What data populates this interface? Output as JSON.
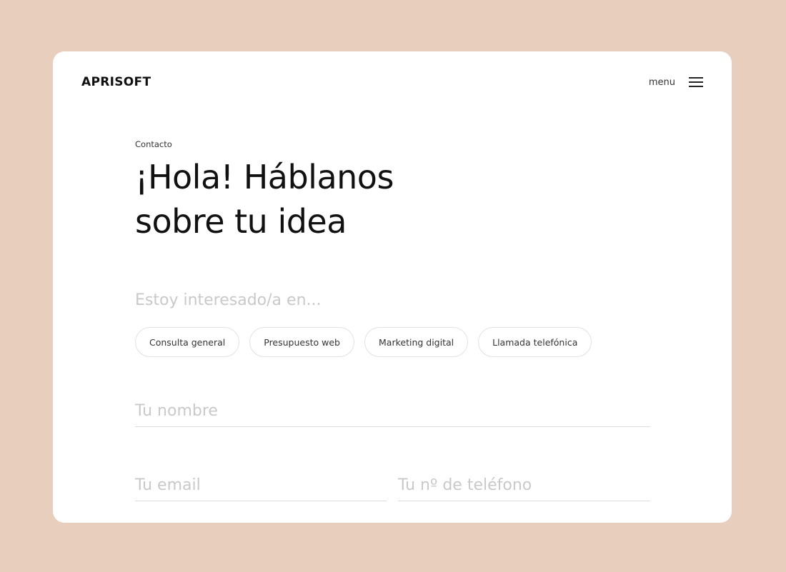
{
  "header": {
    "brand": "APRISOFT",
    "menu_label": "menu"
  },
  "hero": {
    "eyebrow": "Contacto",
    "title_line1": "¡Hola! Háblanos",
    "title_line2": "sobre tu idea"
  },
  "interest": {
    "label": "Estoy interesado/a en...",
    "options": [
      "Consulta general",
      "Presupuesto web",
      "Marketing digital",
      "Llamada telefónica"
    ]
  },
  "form": {
    "name_placeholder": "Tu nombre",
    "email_placeholder": "Tu email",
    "phone_placeholder": "Tu nº de teléfono"
  },
  "colors": {
    "page_background": "#e8cfbd",
    "card_background": "#ffffff",
    "text_primary": "#111111",
    "placeholder": "#c9c9c9"
  },
  "icons": {
    "menu": "hamburger-icon"
  }
}
